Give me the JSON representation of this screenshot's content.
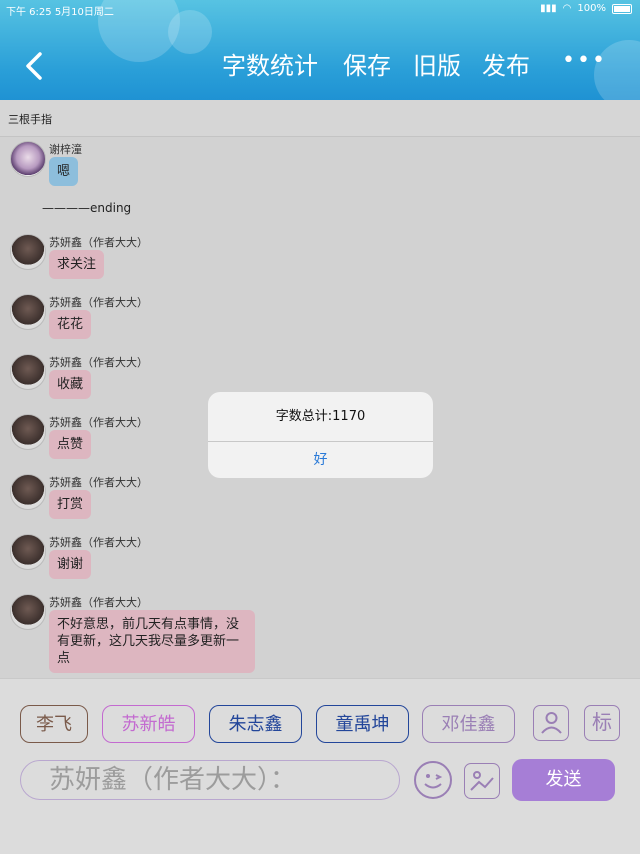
{
  "status_bar": {
    "time_date": "下午 6:25   5月10日周二",
    "battery": "100%"
  },
  "header": {
    "back_icon": "chevron-left-icon",
    "word_count": "字数统计",
    "save": "保存",
    "old_version": "旧版",
    "publish": "发布",
    "more": "•••"
  },
  "chat_title": "三根手指",
  "messages": [
    {
      "sender": "谢梓潼",
      "text": "嗯",
      "style": "blue"
    },
    {
      "sender": "苏妍鑫（作者大大）",
      "text": "求关注"
    },
    {
      "sender": "苏妍鑫（作者大大）",
      "text": "花花"
    },
    {
      "sender": "苏妍鑫（作者大大）",
      "text": "收藏"
    },
    {
      "sender": "苏妍鑫（作者大大）",
      "text": "点赞"
    },
    {
      "sender": "苏妍鑫（作者大大）",
      "text": "打赏"
    },
    {
      "sender": "苏妍鑫（作者大大）",
      "text": "谢谢"
    },
    {
      "sender": "苏妍鑫（作者大大）",
      "text": "不好意思，前几天有点事情，没有更新，这几天我尽量多更新一点"
    }
  ],
  "ending_text": "————ending",
  "dialog": {
    "message": "字数总计:1170",
    "ok": "好"
  },
  "characters": [
    {
      "name": "李飞",
      "color": "#7a5a4a"
    },
    {
      "name": "苏新皓",
      "color": "#c36ad0"
    },
    {
      "name": "朱志鑫",
      "color": "#23469a"
    },
    {
      "name": "童禹坤",
      "color": "#23469a"
    },
    {
      "name": "邓佳鑫",
      "color": "#9a7fb5"
    }
  ],
  "input": {
    "current_speaker": "苏妍鑫（作者大大）："
  },
  "icons": {
    "person": "person-icon",
    "mark": "标",
    "emoji": "emoji-icon",
    "image": "image-icon"
  },
  "send_label": "发送"
}
